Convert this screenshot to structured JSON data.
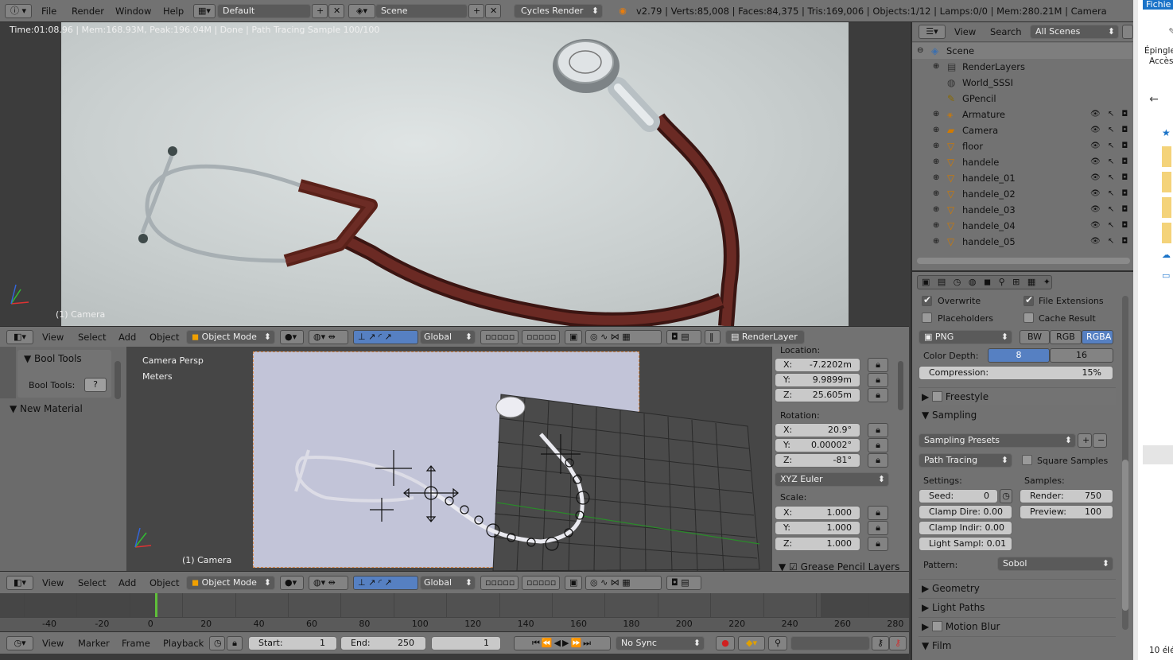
{
  "topbar": {
    "menus": [
      "File",
      "Render",
      "Window",
      "Help"
    ],
    "screen_layout": "Default",
    "scene": "Scene",
    "engine": "Cycles Render",
    "stats": "v2.79 | Verts:85,008 | Faces:84,375 | Tris:169,006 | Objects:1/12 | Lamps:0/0 | Mem:280.21M | Camera"
  },
  "render_view": {
    "status": "Time:01:08.96 | Mem:168.93M, Peak:196.04M | Done | Path Tracing Sample 100/100",
    "camera_label": "(1) Camera"
  },
  "view_header": {
    "menus": [
      "View",
      "Select",
      "Add",
      "Object"
    ],
    "mode": "Object Mode",
    "orientation": "Global",
    "render_layer": "RenderLayer"
  },
  "tool_shelf": {
    "panel1": "Bool Tools",
    "bool_label": "Bool Tools:",
    "panel2": "New Material"
  },
  "viewport": {
    "persp": "Camera Persp",
    "units": "Meters",
    "camera_label": "(1) Camera"
  },
  "n_panel": {
    "location_label": "Location:",
    "loc": [
      {
        "axis": "X:",
        "value": "-7.2202m"
      },
      {
        "axis": "Y:",
        "value": "9.9899m"
      },
      {
        "axis": "Z:",
        "value": "25.605m"
      }
    ],
    "rotation_label": "Rotation:",
    "rot": [
      {
        "axis": "X:",
        "value": "20.9°"
      },
      {
        "axis": "Y:",
        "value": "0.00002°"
      },
      {
        "axis": "Z:",
        "value": "-81°"
      }
    ],
    "rot_mode": "XYZ Euler",
    "scale_label": "Scale:",
    "scale": [
      {
        "axis": "X:",
        "value": "1.000"
      },
      {
        "axis": "Y:",
        "value": "1.000"
      },
      {
        "axis": "Z:",
        "value": "1.000"
      }
    ],
    "grease": "Grease Pencil Layers"
  },
  "timeline": {
    "ticks": [
      "-40",
      "-20",
      "0",
      "20",
      "40",
      "60",
      "80",
      "100",
      "120",
      "140",
      "160",
      "180",
      "200",
      "220",
      "240",
      "260",
      "280"
    ],
    "menus": [
      "View",
      "Marker",
      "Frame",
      "Playback"
    ],
    "start_label": "Start:",
    "start": "1",
    "end_label": "End:",
    "end": "250",
    "current": "1",
    "sync": "No Sync"
  },
  "outliner": {
    "menus": [
      "View",
      "Search"
    ],
    "filter": "All Scenes",
    "items": [
      {
        "name": "Scene",
        "indent": 0,
        "vis": false
      },
      {
        "name": "RenderLayers",
        "indent": 1,
        "vis": false
      },
      {
        "name": "World_SSSI",
        "indent": 1,
        "vis": false
      },
      {
        "name": "GPencil",
        "indent": 1,
        "vis": false
      },
      {
        "name": "Armature",
        "indent": 1,
        "vis": true
      },
      {
        "name": "Camera",
        "indent": 1,
        "vis": true
      },
      {
        "name": "floor",
        "indent": 1,
        "vis": true
      },
      {
        "name": "handele",
        "indent": 1,
        "vis": true
      },
      {
        "name": "handele_01",
        "indent": 1,
        "vis": true
      },
      {
        "name": "handele_02",
        "indent": 1,
        "vis": true
      },
      {
        "name": "handele_03",
        "indent": 1,
        "vis": true
      },
      {
        "name": "handele_04",
        "indent": 1,
        "vis": true
      },
      {
        "name": "handele_05",
        "indent": 1,
        "vis": true
      }
    ]
  },
  "properties": {
    "overwrite": "Overwrite",
    "file_ext": "File Extensions",
    "placeholders": "Placeholders",
    "cache": "Cache Result",
    "format": "PNG",
    "bw": "BW",
    "rgb": "RGB",
    "rgba": "RGBA",
    "color_depth_label": "Color Depth:",
    "depth_8": "8",
    "depth_16": "16",
    "compression_label": "Compression:",
    "compression": "15%",
    "freestyle": "Freestyle",
    "sampling": "Sampling",
    "presets": "Sampling Presets",
    "integrator": "Path Tracing",
    "square": "Square Samples",
    "settings_label": "Settings:",
    "samples_label": "Samples:",
    "seed_label": "Seed:",
    "seed": "0",
    "clamp_direct": "Clamp Dire: 0.00",
    "clamp_indirect": "Clamp Indir: 0.00",
    "light_sampling": "Light Sampl: 0.01",
    "render_label": "Render:",
    "render": "750",
    "preview_label": "Preview:",
    "preview": "100",
    "pattern_label": "Pattern:",
    "pattern": "Sobol",
    "geometry": "Geometry",
    "light_paths": "Light Paths",
    "motion_blur": "Motion Blur",
    "film": "Film"
  },
  "explorer": {
    "ribbon": "Fichie",
    "pin1": "Épingle",
    "pin2": "Accès",
    "count": "10 élé"
  }
}
